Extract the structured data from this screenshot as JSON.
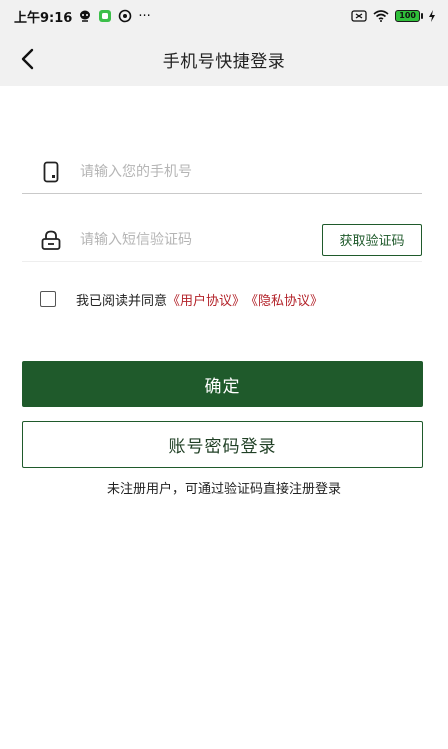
{
  "status_bar": {
    "time": "上午9:16",
    "more": "···",
    "battery": "100"
  },
  "nav": {
    "title": "手机号快捷登录"
  },
  "form": {
    "phone_placeholder": "请输入您的手机号",
    "code_placeholder": "请输入短信验证码",
    "get_code_label": "获取验证码"
  },
  "agreement": {
    "prefix": "我已阅读并同意",
    "user_agreement": "《用户协议》",
    "privacy_policy": "《隐私协议》",
    "checked": false
  },
  "actions": {
    "confirm_label": "确定",
    "account_login_label": "账号密码登录"
  },
  "hint": "未注册用户，可通过验证码直接注册登录",
  "colors": {
    "primary": "#1f5a2b",
    "link": "#b3232a",
    "header_bg": "#f1f1f1"
  }
}
